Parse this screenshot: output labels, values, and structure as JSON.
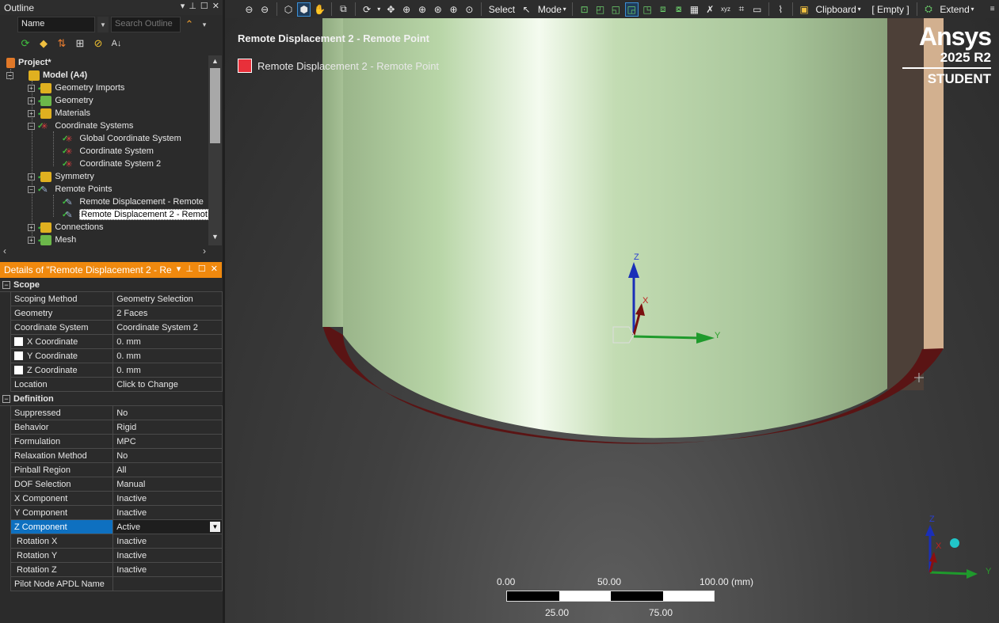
{
  "outline": {
    "title": "Outline",
    "name_select": "Name",
    "search_placeholder": "Search Outline",
    "tree": [
      {
        "label": "Project*"
      },
      {
        "label": "Model (A4)"
      },
      {
        "label": "Geometry Imports"
      },
      {
        "label": "Geometry"
      },
      {
        "label": "Materials"
      },
      {
        "label": "Coordinate Systems"
      },
      {
        "label": "Global Coordinate System"
      },
      {
        "label": "Coordinate System"
      },
      {
        "label": "Coordinate System 2"
      },
      {
        "label": "Symmetry"
      },
      {
        "label": "Remote Points"
      },
      {
        "label": "Remote Displacement - Remote"
      },
      {
        "label": "Remote Displacement 2 - Remot"
      },
      {
        "label": "Connections"
      },
      {
        "label": "Mesh"
      }
    ]
  },
  "details": {
    "title": "Details of \"Remote Displacement 2 - Re",
    "sections": {
      "scope": "Scope",
      "definition": "Definition"
    },
    "rows": [
      {
        "key": "Scoping Method",
        "value": "Geometry Selection"
      },
      {
        "key": "Geometry",
        "value": "2 Faces"
      },
      {
        "key": "Coordinate System",
        "value": "Coordinate System 2"
      },
      {
        "key": "X Coordinate",
        "value": "0. mm"
      },
      {
        "key": "Y Coordinate",
        "value": "0. mm"
      },
      {
        "key": "Z Coordinate",
        "value": "0. mm"
      },
      {
        "key": "Location",
        "value": "Click to Change"
      },
      {
        "key": "Suppressed",
        "value": "No"
      },
      {
        "key": "Behavior",
        "value": "Rigid"
      },
      {
        "key": "Formulation",
        "value": "MPC"
      },
      {
        "key": "Relaxation Method",
        "value": "No"
      },
      {
        "key": "Pinball Region",
        "value": "All"
      },
      {
        "key": "DOF Selection",
        "value": "Manual"
      },
      {
        "key": "X Component",
        "value": "Inactive"
      },
      {
        "key": "Y Component",
        "value": "Inactive"
      },
      {
        "key": "Z Component",
        "value": "Active"
      },
      {
        "key": "Rotation X",
        "value": "Inactive"
      },
      {
        "key": "Rotation Y",
        "value": "Inactive"
      },
      {
        "key": "Rotation Z",
        "value": "Inactive"
      },
      {
        "key": "Pilot Node APDL Name",
        "value": ""
      }
    ]
  },
  "toolbar": {
    "select": "Select",
    "mode": "Mode",
    "clipboard": "Clipboard",
    "empty": "[ Empty ]",
    "extend": "Extend"
  },
  "viewport": {
    "title": "Remote Displacement 2 - Remote Point",
    "legend_label": "Remote Displacement 2 - Remote Point",
    "legend_color": "#e8303a",
    "brand": {
      "logo": "Ansys",
      "version": "2025 R2",
      "edition": "STUDENT"
    },
    "axis": {
      "x": "X",
      "y": "Y",
      "z": "Z"
    },
    "scale": {
      "t0": "0.00",
      "t50": "50.00",
      "t100": "100.00 (mm)",
      "t25": "25.00",
      "t75": "75.00"
    }
  },
  "colors": {
    "accent": "#f0890e",
    "selection": "#0e70c0"
  }
}
